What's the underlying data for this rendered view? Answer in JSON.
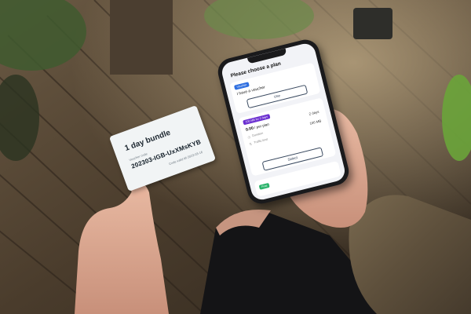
{
  "card": {
    "title": "1 day bundle",
    "code_label": "Voucher code",
    "code": "202303-IGB-UxXMsKYB",
    "valid": "Code valid till 2023-03-16"
  },
  "phone": {
    "title": "Please choose a plan",
    "voucher_tag": "Voucher",
    "voucher_text": "I have a voucher",
    "use_button": "Use",
    "plan_tag": "100 MB for 2 days",
    "price_amount": "0.00",
    "price_unit": "/ per plan",
    "duration_label": "Duration",
    "duration_value": "2 days",
    "traffic_label": "Traffic limit",
    "traffic_value": "100 MB",
    "select_button": "Select",
    "free_tag": "Free"
  }
}
